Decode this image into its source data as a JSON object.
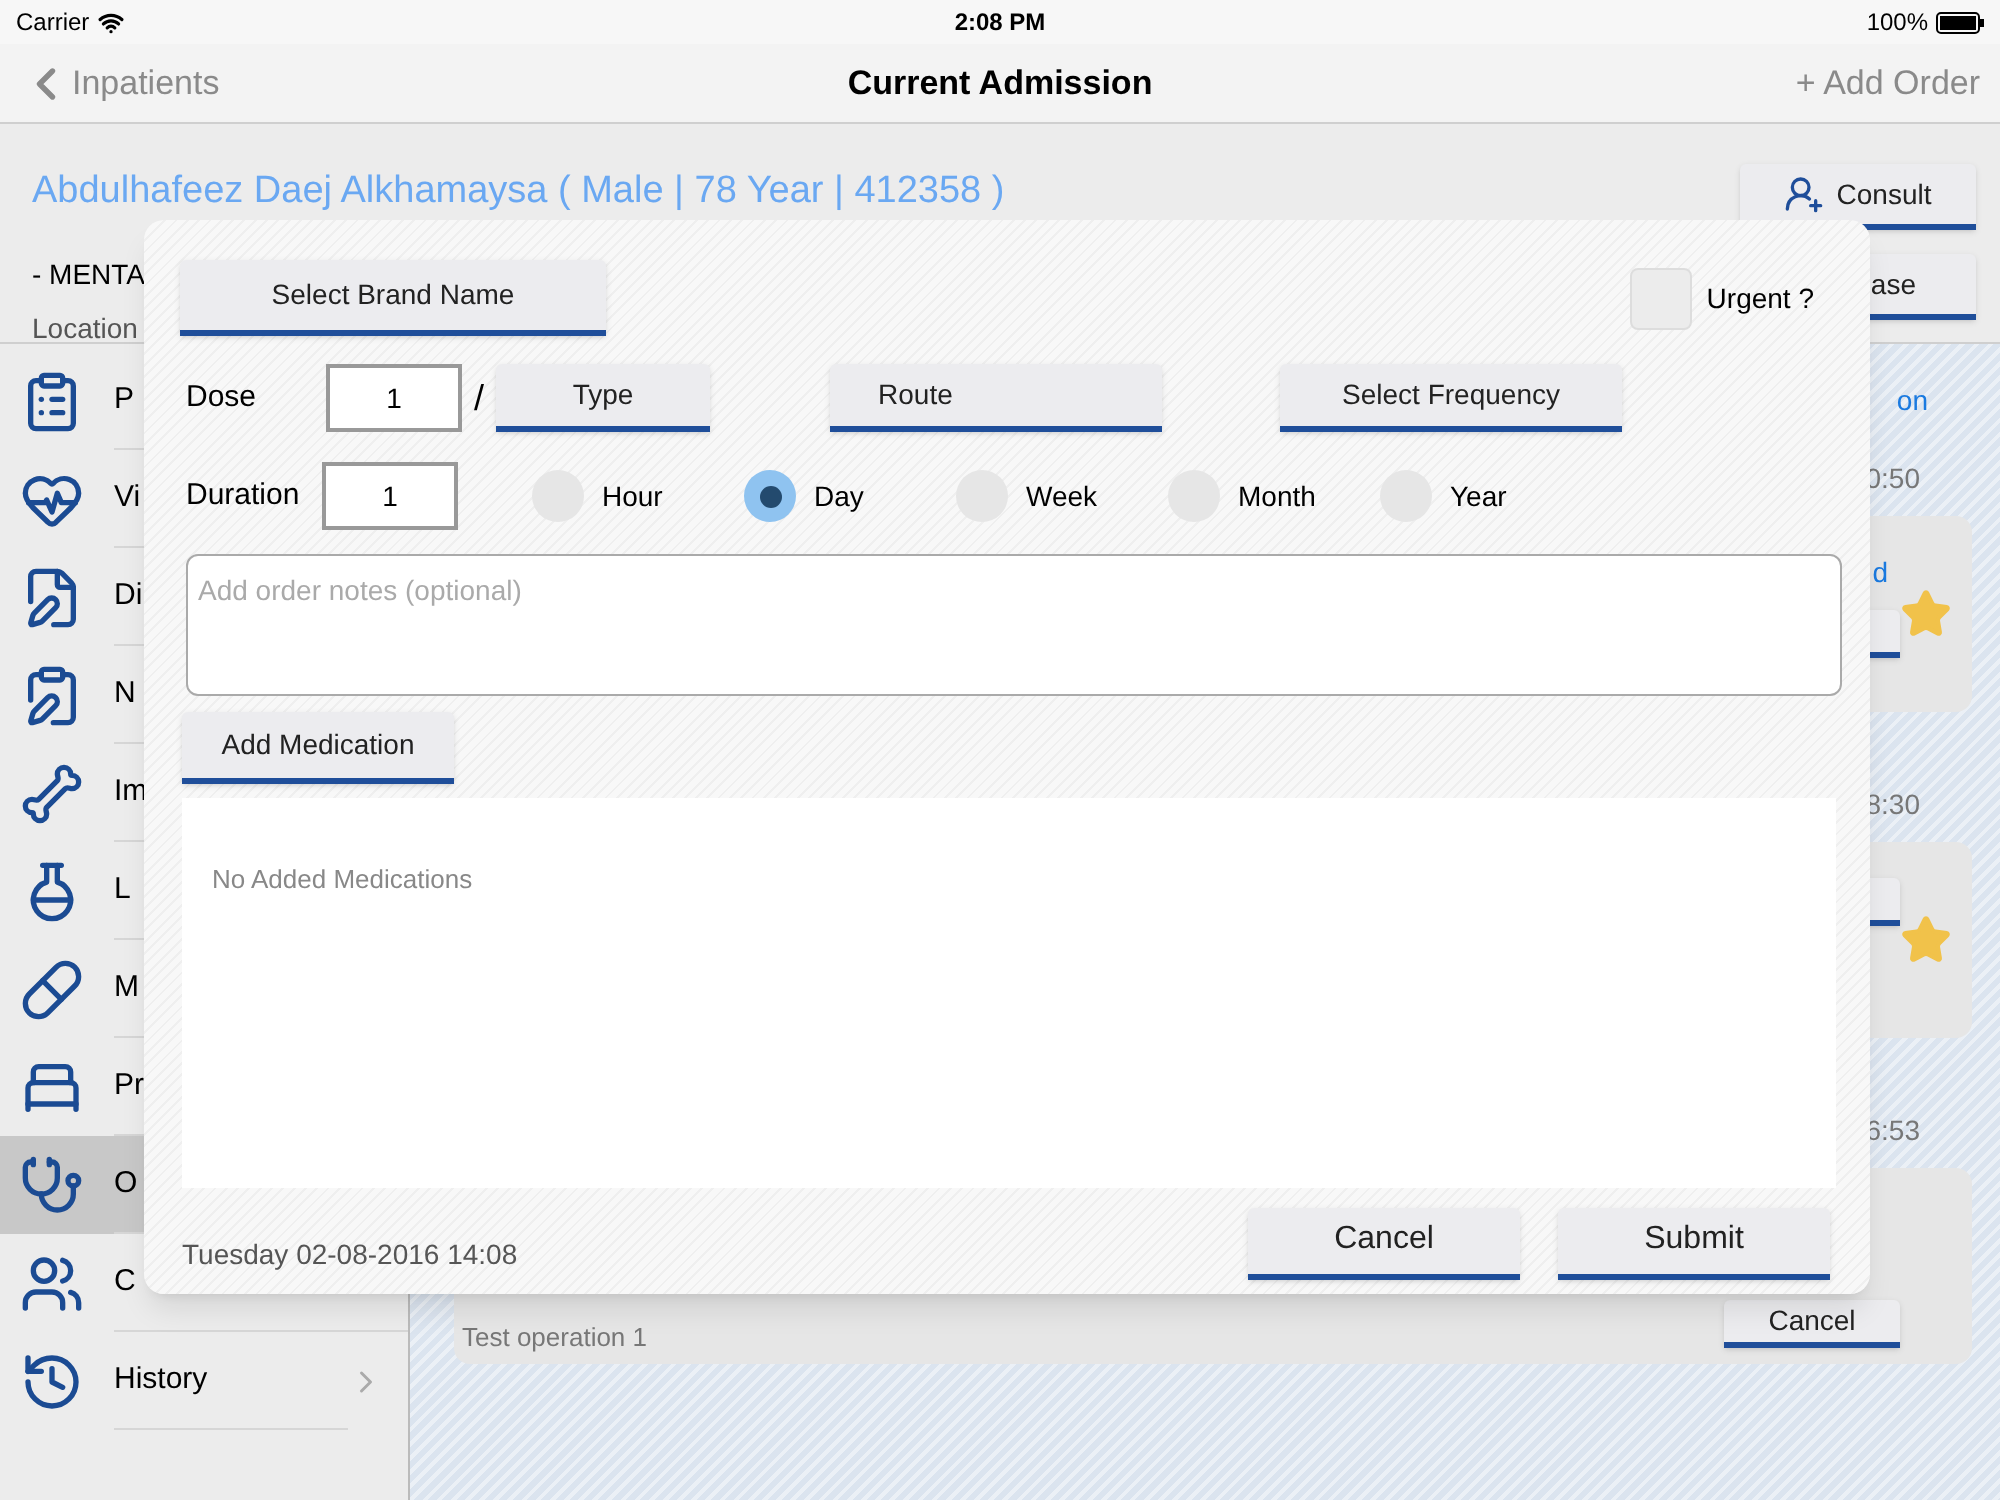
{
  "status_bar": {
    "carrier": "Carrier",
    "time": "2:08 PM",
    "battery": "100%"
  },
  "nav_bar": {
    "back": "Inpatients",
    "title": "Current Admission",
    "action": "+ Add Order"
  },
  "patient": {
    "name": "Abdulhafeez Daej Alkhamaysa ( Male | 78 Year | 412358 )",
    "ward": "- MENTA",
    "location": "Location",
    "buttons": [
      "Consult",
      "ase"
    ]
  },
  "sidebar": {
    "items": [
      {
        "label": "P",
        "selected": false
      },
      {
        "label": "Vi",
        "selected": false
      },
      {
        "label": "Di",
        "selected": false
      },
      {
        "label": "N",
        "selected": false
      },
      {
        "label": "Im",
        "selected": false
      },
      {
        "label": "L",
        "selected": false
      },
      {
        "label": "M",
        "selected": false
      },
      {
        "label": "Pr",
        "selected": false
      },
      {
        "label": "O",
        "selected": true
      },
      {
        "label": "C",
        "selected": false
      },
      {
        "label": "History",
        "selected": false
      }
    ]
  },
  "timeline": {
    "link": "on",
    "entries": [
      {
        "time": "0:50",
        "link": "d",
        "starred": true
      },
      {
        "time": "8:30",
        "starred": true
      },
      {
        "time": "6:53",
        "note": "Test operation 1",
        "button": "Cancel",
        "starred": false
      }
    ]
  },
  "order_dialog": {
    "brand_button": "Select Brand Name",
    "urgent": {
      "label": "Urgent ?",
      "checked": false
    },
    "dose": {
      "label": "Dose",
      "value": "1",
      "separator": "/"
    },
    "type_button": "Type",
    "route_button": "Route",
    "frequency_button": "Select Frequency",
    "duration": {
      "label": "Duration",
      "value": "1"
    },
    "units": [
      {
        "label": "Hour",
        "selected": false
      },
      {
        "label": "Day",
        "selected": true
      },
      {
        "label": "Week",
        "selected": false
      },
      {
        "label": "Month",
        "selected": false
      },
      {
        "label": "Year",
        "selected": false
      }
    ],
    "notes": {
      "placeholder": "Add order notes (optional)"
    },
    "add_button": "Add Medication",
    "empty_message": "No Added Medications",
    "date": "Tuesday 02-08-2016 14:08",
    "buttons": [
      "Cancel",
      "Submit"
    ]
  }
}
